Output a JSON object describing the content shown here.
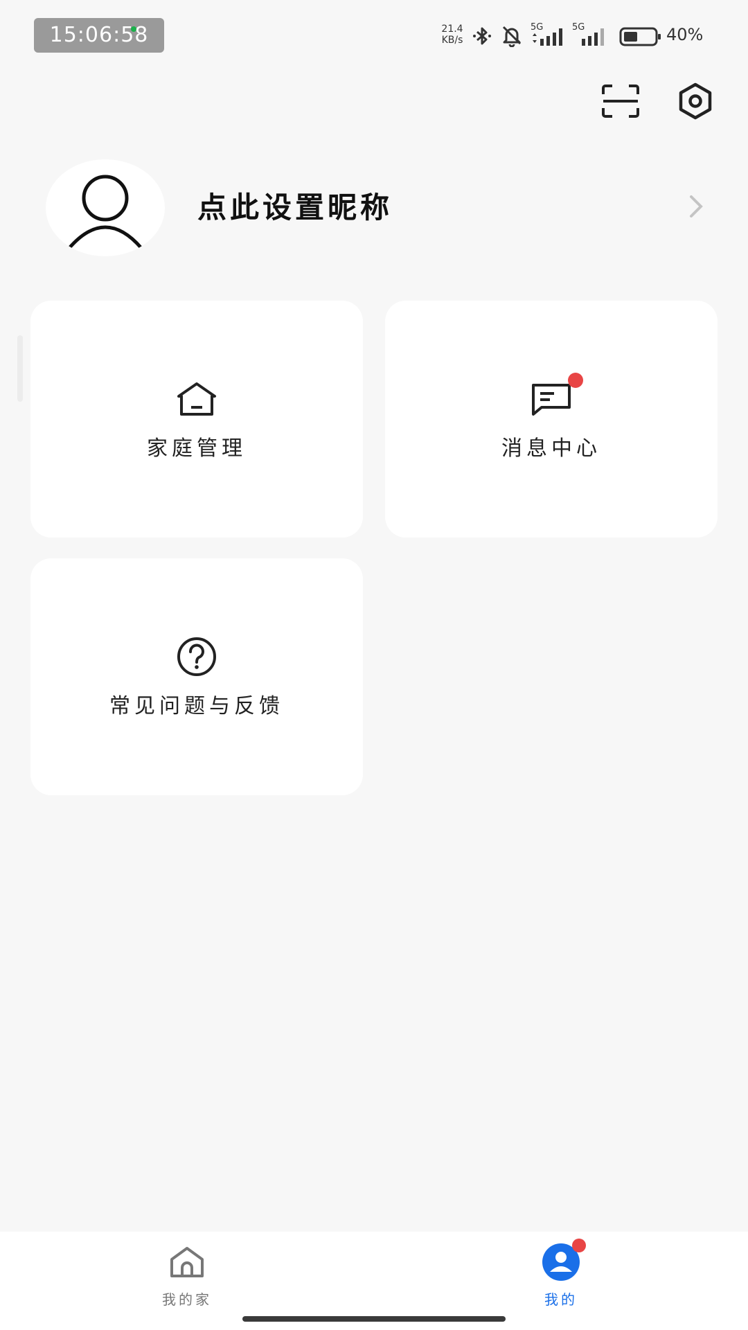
{
  "status_bar": {
    "time": "15:06:58",
    "net_speed_value": "21.4",
    "net_speed_unit": "KB/s",
    "sim1_label": "5G",
    "sim2_label": "5G",
    "battery_percent": "40%",
    "icons": [
      "bluetooth-icon",
      "mute-bell-icon",
      "signal-icon",
      "battery-icon"
    ]
  },
  "header": {
    "scan_icon": "scan-icon",
    "settings_icon": "settings-hexagon-icon"
  },
  "profile": {
    "nickname_prompt": "点此设置昵称",
    "avatar_icon": "person-icon",
    "chevron_icon": "chevron-right-icon"
  },
  "cards": [
    {
      "label": "家庭管理",
      "icon": "home-icon",
      "badge": false
    },
    {
      "label": "消息中心",
      "icon": "message-icon",
      "badge": true
    },
    {
      "label": "常见问题与反馈",
      "icon": "question-icon",
      "badge": false
    }
  ],
  "bottom_nav": {
    "items": [
      {
        "label": "我的家",
        "icon": "home-icon",
        "active": false
      },
      {
        "label": "我的",
        "icon": "user-icon",
        "active": true,
        "badge": true
      }
    ],
    "active_color": "#1a6fe8",
    "inactive_color": "#777777"
  },
  "colors": {
    "background": "#f7f7f7",
    "card": "#ffffff",
    "badge": "#e84545",
    "accent": "#1a6fe8"
  }
}
